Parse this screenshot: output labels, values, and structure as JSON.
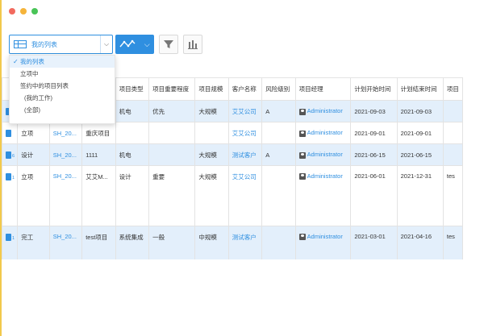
{
  "toolbar": {
    "view_select_value": "我的列表"
  },
  "dropdown": {
    "items": [
      "我的列表",
      "立项中",
      "签约中的项目列表",
      "(我的工作)",
      "(全部)"
    ]
  },
  "table": {
    "headers": [
      "",
      "",
      "",
      "",
      "项目类型",
      "项目重要程度",
      "项目规模",
      "客户名称",
      "风险级别",
      "项目经理",
      "计划开始时间",
      "计划结束时间",
      "项目"
    ],
    "rows": [
      {
        "icon_sub": "",
        "status": "",
        "code": "",
        "name": "",
        "type": "机电",
        "importance": "优先",
        "scale": "大规模",
        "customer": "艾艾公司",
        "risk": "A",
        "manager": "Administrator",
        "start": "2021-09-03",
        "end": "2021-09-03",
        "extra": ""
      },
      {
        "icon_sub": "",
        "status": "立项",
        "code": "SH_20...",
        "name": "重庆项目",
        "type": "",
        "importance": "",
        "scale": "",
        "customer": "艾艾公司",
        "risk": "",
        "manager": "Administrator",
        "start": "2021-09-01",
        "end": "2021-09-01",
        "extra": ""
      },
      {
        "icon_sub": "6",
        "status": "设计",
        "code": "SH_20...",
        "name": "1111",
        "type": "机电",
        "importance": "",
        "scale": "大规模",
        "customer": "测试客户",
        "risk": "A",
        "manager": "Administrator",
        "start": "2021-06-15",
        "end": "2021-06-15",
        "extra": ""
      },
      {
        "icon_sub": "1",
        "status": "立项",
        "code": "SH_20...",
        "name": "艾艾M...",
        "type": "设计",
        "importance": "重要",
        "scale": "大规模",
        "customer": "艾艾公司",
        "risk": "",
        "manager": "Administrator",
        "start": "2021-06-01",
        "end": "2021-12-31",
        "extra": "tes"
      },
      {
        "icon_sub": "1",
        "status": "完工",
        "code": "SH_20...",
        "name": "test项目",
        "type": "系统集成",
        "importance": "一般",
        "scale": "中规模",
        "customer": "测试客户",
        "risk": "",
        "manager": "Administrator",
        "start": "2021-03-01",
        "end": "2021-04-16",
        "extra": "tes"
      }
    ]
  }
}
